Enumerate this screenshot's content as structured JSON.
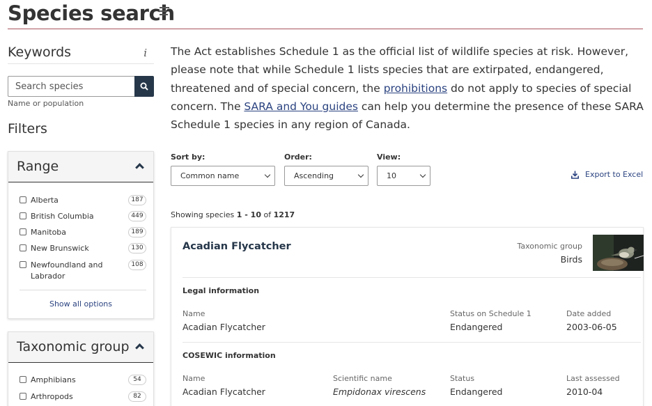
{
  "header": {
    "title": "Species search"
  },
  "sidebar": {
    "keywords_title": "Keywords",
    "info_icon": "i",
    "search_placeholder": "Search species",
    "search_hint": "Name or population",
    "filters_title": "Filters",
    "range": {
      "title": "Range",
      "options": [
        {
          "label": "Alberta",
          "count": "187"
        },
        {
          "label": "British Columbia",
          "count": "449"
        },
        {
          "label": "Manitoba",
          "count": "189"
        },
        {
          "label": "New Brunswick",
          "count": "130"
        },
        {
          "label": "Newfoundland and Labrador",
          "count": "108"
        }
      ],
      "show_all": "Show all options"
    },
    "taxonomic_group": {
      "title": "Taxonomic group",
      "options": [
        {
          "label": "Amphibians",
          "count": "54"
        },
        {
          "label": "Arthropods",
          "count": "82"
        }
      ]
    }
  },
  "intro": {
    "text_1": "The Act establishes Schedule 1 as the official list of wildlife species at risk. However, please note that while Schedule 1 lists species that are extirpated, endangered, threatened and of special concern, the ",
    "link_1": "prohibitions",
    "text_2": " do not apply to species of special concern. The ",
    "link_2": "SARA and You guides",
    "text_3": " can help you determine the presence of these SARA Schedule 1 species in any region of Canada."
  },
  "controls": {
    "sort_label": "Sort by:",
    "sort_value": "Common name",
    "order_label": "Order:",
    "order_value": "Ascending",
    "view_label": "View:",
    "view_value": "10",
    "export_label": "Export to Excel"
  },
  "results": {
    "showing_prefix": "Showing species ",
    "range": "1 - 10",
    "of": " of ",
    "total": "1217"
  },
  "card": {
    "name": "Acadian Flycatcher",
    "taxonomic_group_label": "Taxonomic group",
    "taxonomic_group_value": "Birds",
    "legal_title": "Legal information",
    "legal_name_label": "Name",
    "legal_name": "Acadian Flycatcher",
    "schedule_status_label": "Status on Schedule 1",
    "schedule_status": "Endangered",
    "date_added_label": "Date added",
    "date_added": "2003-06-05",
    "cosewic_title": "COSEWIC information",
    "cosewic_name_label": "Name",
    "cosewic_name": "Acadian Flycatcher",
    "scientific_label": "Scientific name",
    "scientific_name": "Empidonax virescens",
    "cosewic_status_label": "Status",
    "cosewic_status": "Endangered",
    "last_assessed_label": "Last assessed",
    "last_assessed": "2010-04"
  },
  "colors": {
    "primary_dark": "#26374a",
    "link": "#2b4380",
    "header_rule": "#a8545b"
  }
}
